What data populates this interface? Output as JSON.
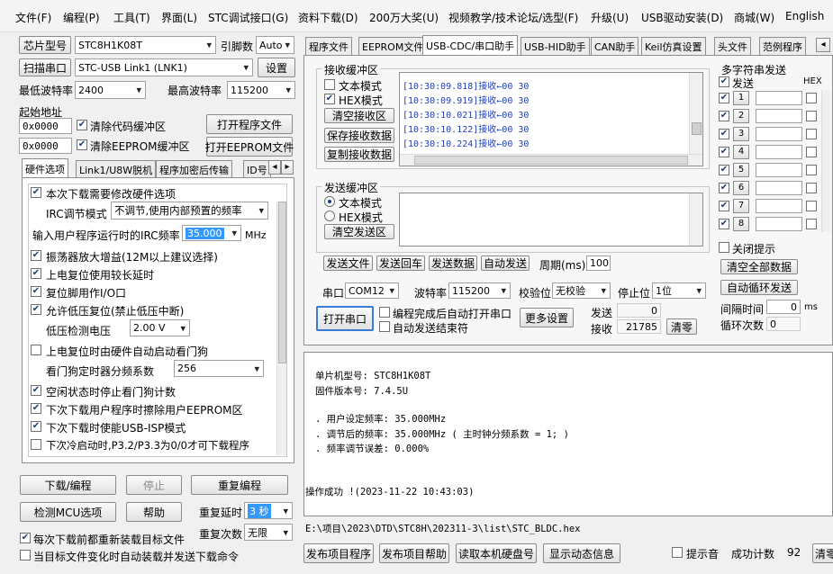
{
  "menu": [
    "文件(F)",
    "编程(P)",
    "工具(T)",
    "界面(L)",
    "STC调试接口(G)",
    "资料下载(D)",
    "200万大奖(U)",
    "视频教学/技术论坛/选型(F)",
    "升级(U)",
    "USB驱动安装(D)",
    "商城(W)",
    "English"
  ],
  "left": {
    "chip_button": "芯片型号",
    "chip_value": "STC8H1K08T",
    "pin_label": "引脚数",
    "pin_value": "Auto",
    "scan_button": "扫描串口",
    "port_value": "STC-USB Link1 (LNK1)",
    "settings_button": "设置",
    "min_baud_label": "最低波特率",
    "min_baud_value": "2400",
    "max_baud_label": "最高波特率",
    "max_baud_value": "115200",
    "start_addr_label": "起始地址",
    "addr1": "0x0000",
    "clear_code_label": "清除代码缓冲区",
    "open_prog_button": "打开程序文件",
    "addr2": "0x0000",
    "clear_eeprom_label": "清除EEPROM缓冲区",
    "open_eeprom_button": "打开EEPROM文件",
    "tabs": [
      "硬件选项",
      "Link1/U8W脱机",
      "程序加密后传输",
      "ID号"
    ],
    "options": {
      "modify_hw": "本次下载需要修改硬件选项",
      "irc_mode_label": "IRC调节模式",
      "irc_mode_value": "不调节,使用内部预置的频率",
      "irc_freq_label": "输入用户程序运行时的IRC频率",
      "irc_freq_value": "35.000",
      "irc_freq_unit": "MHz",
      "osc_gain": "振荡器放大增益(12M以上建议选择)",
      "power_reset_delay": "上电复位使用较长延时",
      "reset_pin_io": "复位脚用作I/O口",
      "lvr": "允许低压复位(禁止低压中断)",
      "lvd_label": "低压检测电压",
      "lvd_value": "2.00 V",
      "wdt_hw": "上电复位时由硬件自动启动看门狗",
      "wdt_div_label": "看门狗定时器分频系数",
      "wdt_div_value": "256",
      "idle_wdt": "空闲状态时停止看门狗计数",
      "erase_eeprom": "下次下载用户程序时擦除用户EEPROM区",
      "usb_isp": "下次下载时使能USB-ISP模式",
      "cold_start": "下次冷启动时,P3.2/P3.3为0/0才可下载程序"
    },
    "download_button": "下载/编程",
    "stop_button": "停止",
    "reprogram_button": "重复编程",
    "detect_button": "检测MCU选项",
    "help_button": "帮助",
    "repeat_delay_label": "重复延时",
    "repeat_delay_value": "3 秒",
    "repeat_count_label": "重复次数",
    "repeat_count_value": "无限",
    "reload_label": "每次下载前都重新装载目标文件",
    "auto_send_label": "当目标文件变化时自动装载并发送下载命令"
  },
  "right": {
    "tabs": [
      "程序文件",
      "EEPROM文件",
      "USB-CDC/串口助手",
      "USB-HID助手",
      "CAN助手",
      "Keil仿真设置",
      "头文件",
      "范例程序"
    ],
    "recv_title": "接收缓冲区",
    "text_mode": "文本模式",
    "hex_mode": "HEX模式",
    "clear_recv": "清空接收区",
    "save_recv": "保存接收数据",
    "copy_recv": "复制接收数据",
    "recv_lines": [
      "[10:30:09.818]接收←00 30",
      "[10:30:09.919]接收←00 30",
      "[10:30:10.021]接收←00 30",
      "[10:30:10.122]接收←00 30",
      "[10:30:10.224]接收←00 30"
    ],
    "send_title": "发送缓冲区",
    "send_text_mode": "文本模式",
    "send_hex_mode": "HEX模式",
    "clear_send": "清空发送区",
    "send_file": "发送文件",
    "send_return": "发送回车",
    "send_data": "发送数据",
    "auto_send": "自动发送",
    "period_label": "周期(ms)",
    "period_value": "100",
    "port_label": "串口",
    "port_value": "COM12",
    "baud_label": "波特率",
    "baud_value": "115200",
    "parity_label": "校验位",
    "parity_value": "无校验",
    "stop_label": "停止位",
    "stop_value": "1位",
    "open_port": "打开串口",
    "auto_open_label": "编程完成后自动打开串口",
    "auto_end_label": "自动发送结束符",
    "more_settings": "更多设置",
    "send_count_label": "发送",
    "send_count_value": "0",
    "recv_count_label": "接收",
    "recv_count_value": "21785",
    "clear_count": "清零",
    "multi_title": "多字符串发送",
    "multi_send": "发送",
    "multi_hex": "HEX",
    "multi_items": [
      "1",
      "2",
      "3",
      "4",
      "5",
      "6",
      "7",
      "8"
    ],
    "close_hint": "关闭提示",
    "clear_all": "清空全部数据",
    "auto_loop": "自动循环发送",
    "interval_label": "间隔时间",
    "interval_value": "0",
    "interval_unit": "ms",
    "loop_count_label": "循环次数",
    "loop_count_value": "0"
  },
  "info": {
    "chip": "单片机型号: STC8H1K08T",
    "firmware": "固件版本号: 7.4.5U",
    "user_freq": ". 用户设定频率: 35.000MHz",
    "adj_freq": ". 调节后的频率: 35.000MHz ( 主时钟分频系数 = 1; )",
    "freq_err": ". 频率调节误差: 0.000%",
    "success": "操作成功 !(2023-11-22 10:43:03)"
  },
  "status": {
    "path": "E:\\项目\\2023\\DTD\\STC8H\\202311-3\\list\\STC_BLDC.hex",
    "publish_prog": "发布项目程序",
    "publish_help": "发布项目帮助",
    "read_disk": "读取本机硬盘号",
    "show_anim": "显示动态信息",
    "beep_label": "提示音",
    "success_count_label": "成功计数",
    "success_count_value": "92",
    "clear_label": "清零"
  }
}
